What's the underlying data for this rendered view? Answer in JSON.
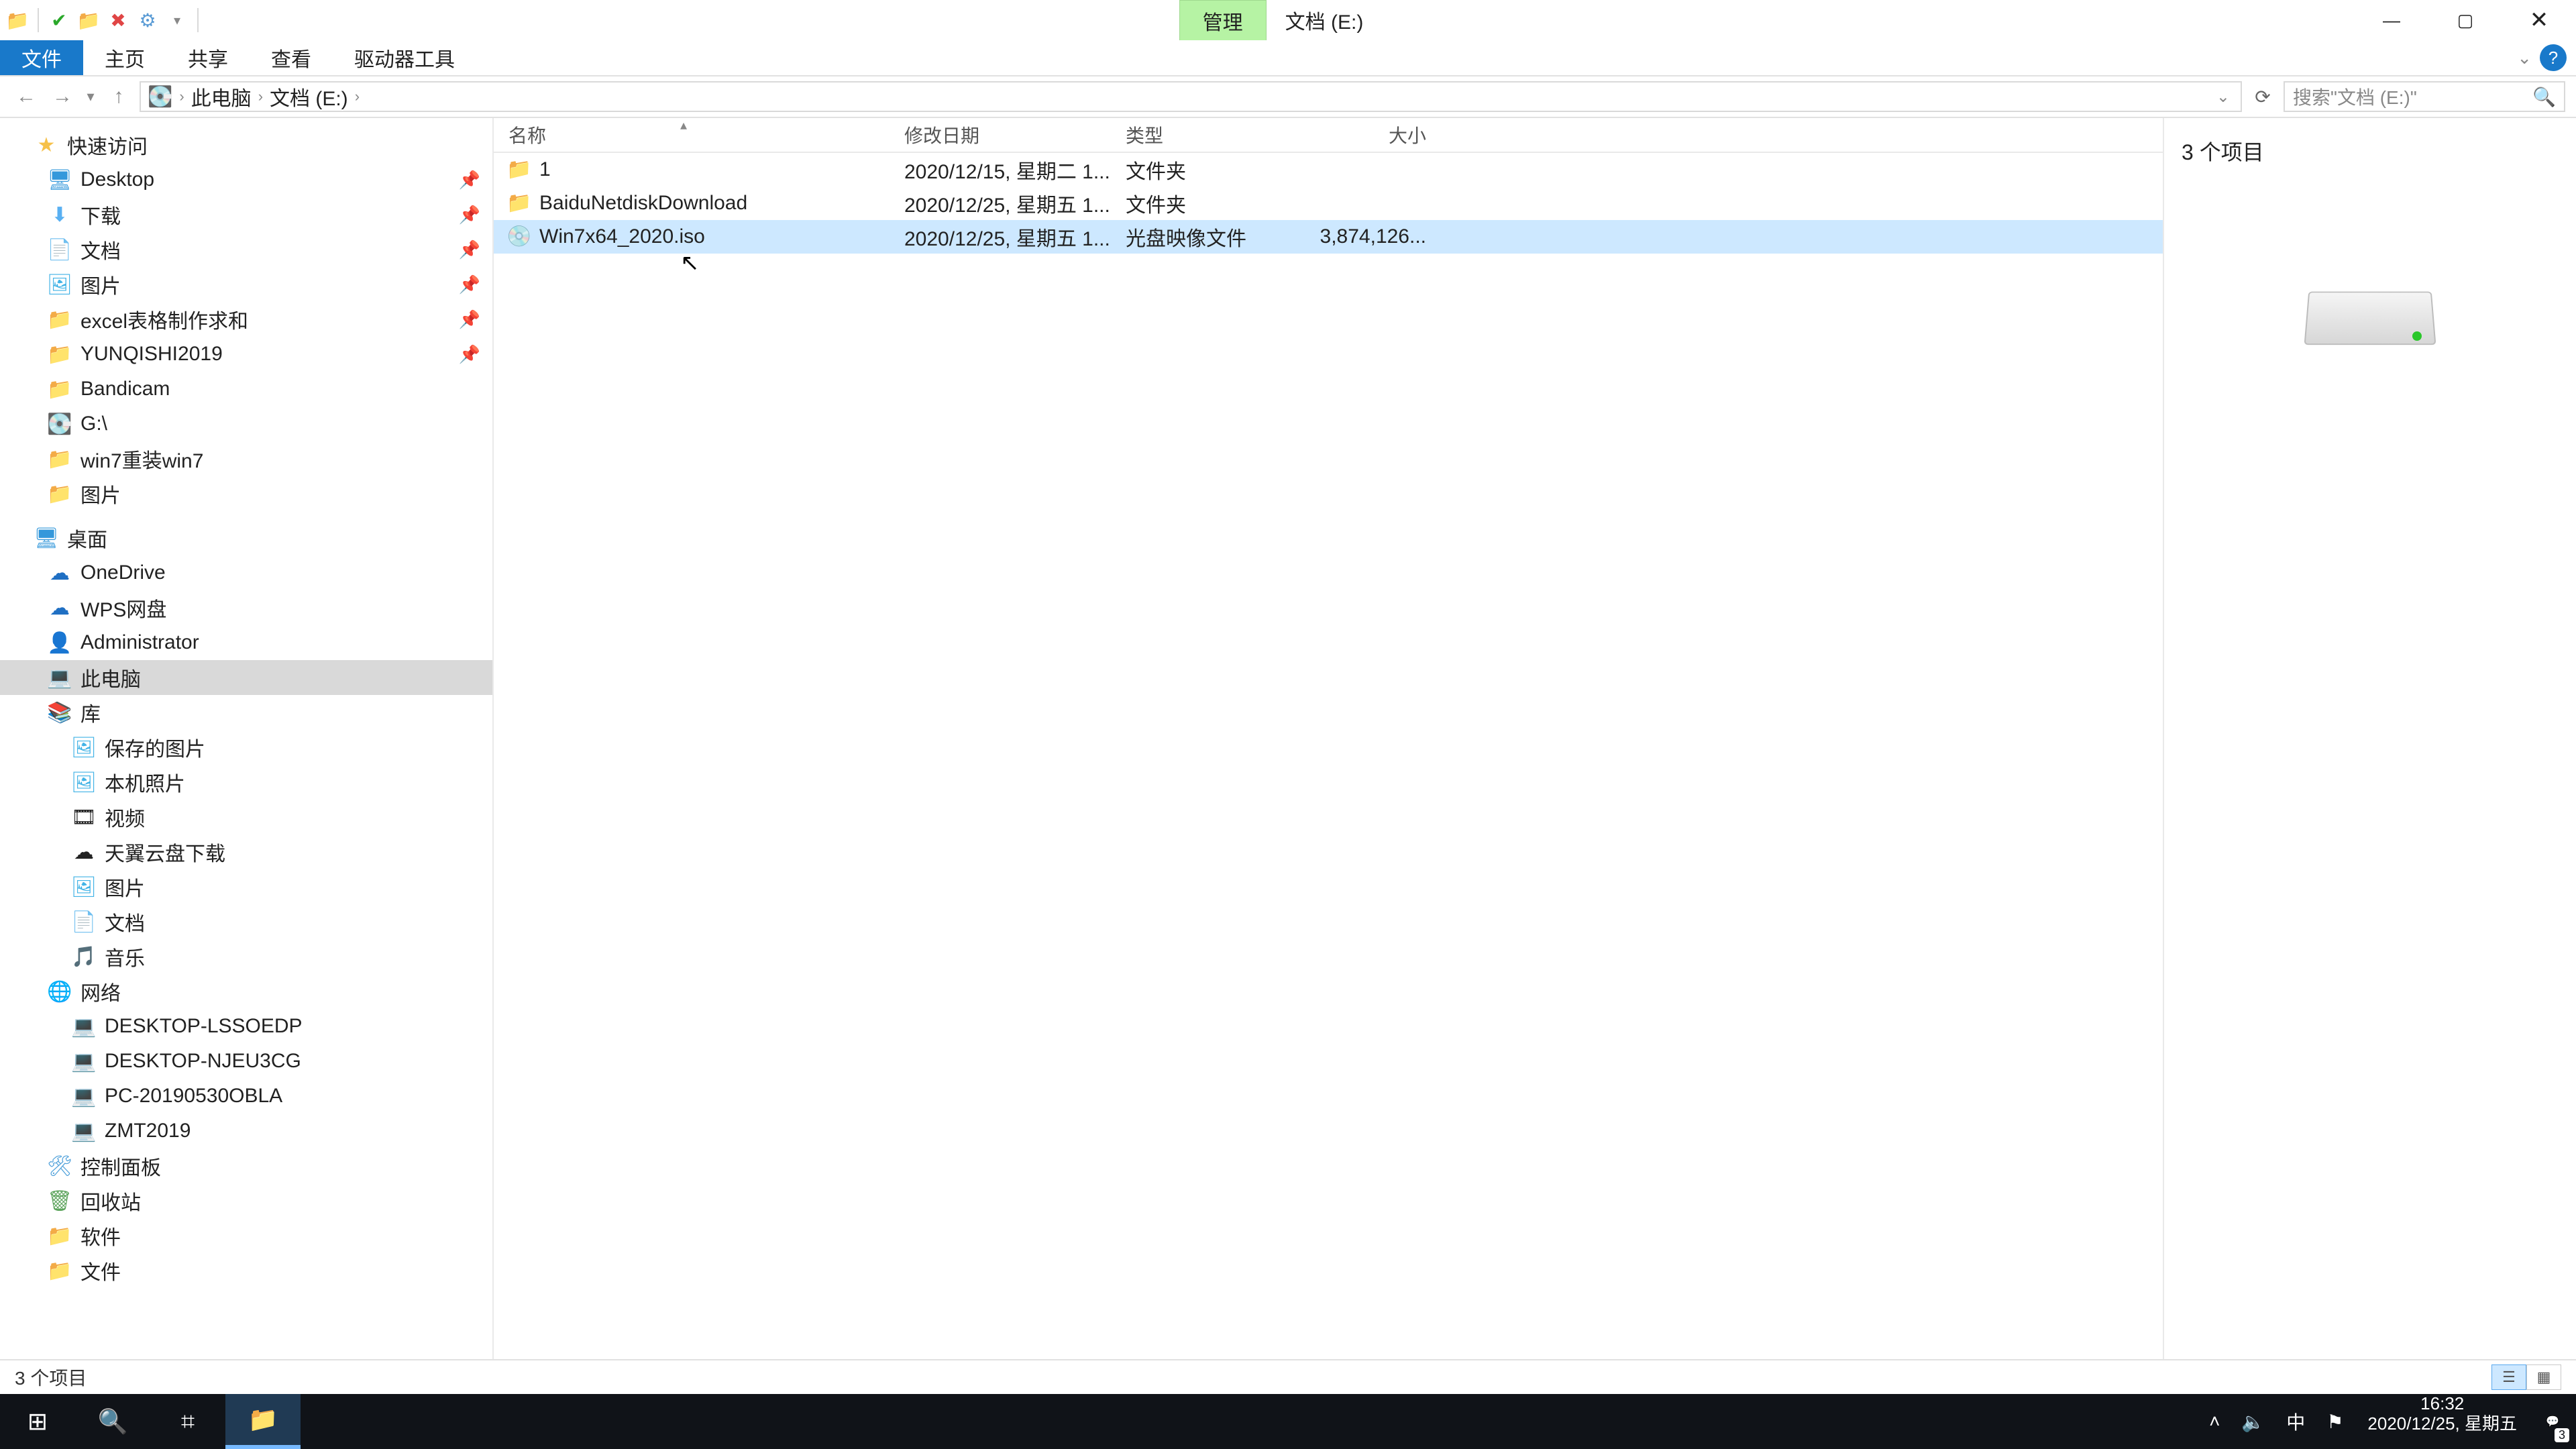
{
  "title": {
    "context_tab": "管理",
    "window_title": "文档 (E:)"
  },
  "ribbon": {
    "file": "文件",
    "home": "主页",
    "share": "共享",
    "view": "查看",
    "drive_tools": "驱动器工具"
  },
  "address": {
    "root": "此电脑",
    "current": "文档 (E:)",
    "search_placeholder": "搜索\"文档 (E:)\""
  },
  "tree": {
    "quick_access": "快速访问",
    "desktop": "Desktop",
    "downloads": "下载",
    "documents": "文档",
    "pictures": "图片",
    "excel": "excel表格制作求和",
    "yunqishi": "YUNQISHI2019",
    "bandicam": "Bandicam",
    "gdrive": "G:\\",
    "win7": "win7重装win7",
    "pictures2": "图片",
    "desktop_cn": "桌面",
    "onedrive": "OneDrive",
    "wps": "WPS网盘",
    "admin": "Administrator",
    "thispc": "此电脑",
    "library": "库",
    "saved_pics": "保存的图片",
    "local_pics": "本机照片",
    "video": "视频",
    "tianyi": "天翼云盘下载",
    "pics3": "图片",
    "docs2": "文档",
    "music": "音乐",
    "network": "网络",
    "pc1": "DESKTOP-LSSOEDP",
    "pc2": "DESKTOP-NJEU3CG",
    "pc3": "PC-20190530OBLA",
    "pc4": "ZMT2019",
    "cpanel": "控制面板",
    "recycle": "回收站",
    "soft": "软件",
    "docs3": "文件"
  },
  "columns": {
    "name": "名称",
    "date": "修改日期",
    "type": "类型",
    "size": "大小"
  },
  "rows": [
    {
      "name": "1",
      "date": "2020/12/15, 星期二 1...",
      "type": "文件夹",
      "size": "",
      "icon": "folder",
      "selected": false
    },
    {
      "name": "BaiduNetdiskDownload",
      "date": "2020/12/25, 星期五 1...",
      "type": "文件夹",
      "size": "",
      "icon": "folder",
      "selected": false
    },
    {
      "name": "Win7x64_2020.iso",
      "date": "2020/12/25, 星期五 1...",
      "type": "光盘映像文件",
      "size": "3,874,126...",
      "icon": "iso",
      "selected": true
    }
  ],
  "preview": {
    "count_label": "3 个项目"
  },
  "status": {
    "text": "3 个项目"
  },
  "taskbar": {
    "time": "16:32",
    "date": "2020/12/25, 星期五",
    "ime": "中",
    "notif_count": "3"
  }
}
